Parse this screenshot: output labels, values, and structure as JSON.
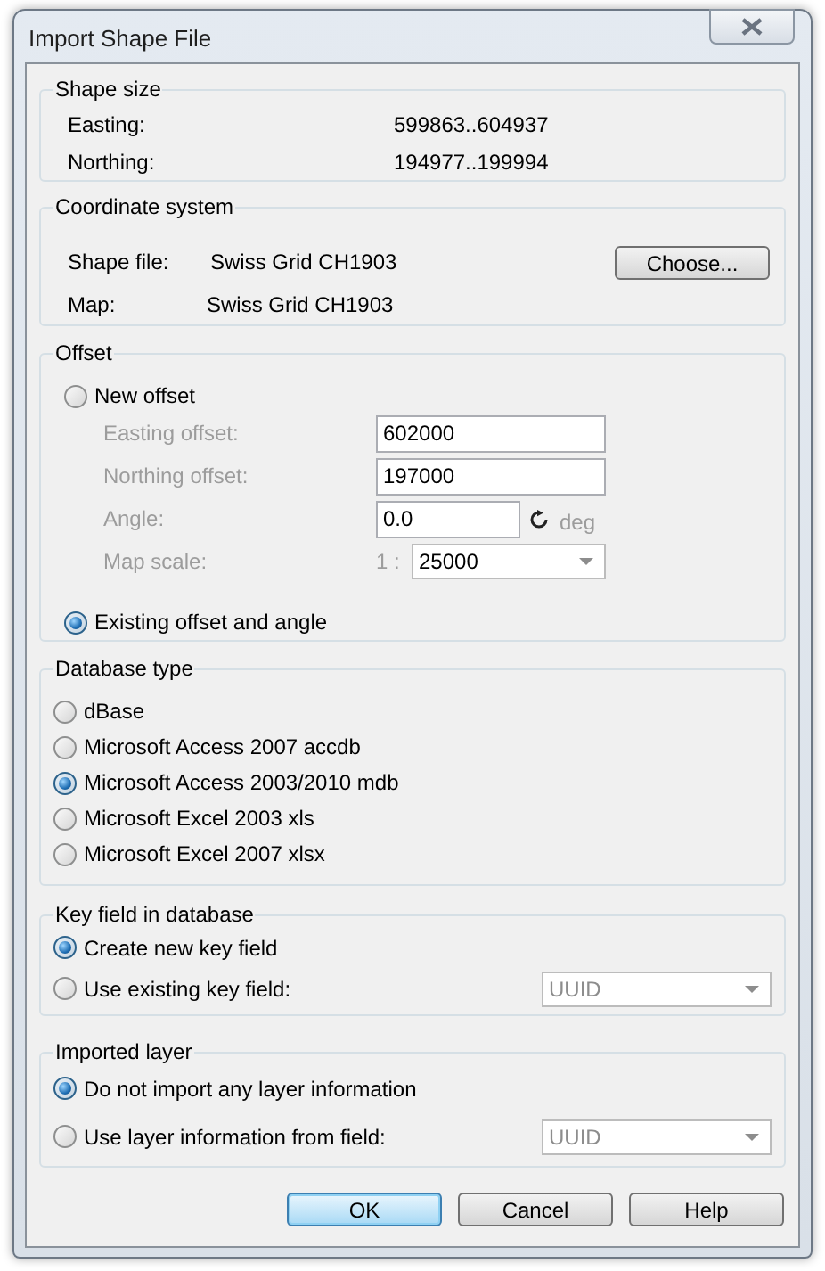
{
  "window": {
    "title": "Import Shape File"
  },
  "shape_size": {
    "title": "Shape size",
    "rows": [
      {
        "label": "Easting:",
        "value": "599863..604937"
      },
      {
        "label": "Northing:",
        "value": "194977..199994"
      }
    ]
  },
  "coordinate_system": {
    "title": "Coordinate system",
    "choose_button": "Choose...",
    "rows": [
      {
        "label": "Shape file:",
        "value": "Swiss Grid CH1903"
      },
      {
        "label": "Map:",
        "value": "Swiss Grid CH1903"
      }
    ]
  },
  "offset": {
    "title": "Offset",
    "new_offset": {
      "label": "New offset",
      "selected": false
    },
    "fields": [
      {
        "kind": "text",
        "label": "Easting offset:",
        "value": "602000",
        "disabled": true
      },
      {
        "kind": "text",
        "label": "Northing offset:",
        "value": "197000",
        "disabled": true
      },
      {
        "kind": "angle",
        "label": "Angle:",
        "value": "0.0",
        "unit": "deg",
        "disabled": true
      },
      {
        "kind": "dropdown",
        "label": "Map scale:",
        "prefix": "1 :",
        "value": "25000",
        "disabled": true
      }
    ],
    "existing_offset": {
      "label": "Existing offset and angle",
      "selected": true
    }
  },
  "database_type": {
    "title": "Database type",
    "options": [
      {
        "label": "dBase",
        "selected": false
      },
      {
        "label": "Microsoft Access 2007 accdb",
        "selected": false
      },
      {
        "label": "Microsoft Access 2003/2010 mdb",
        "selected": true
      },
      {
        "label": "Microsoft Excel 2003 xls",
        "selected": false
      },
      {
        "label": "Microsoft Excel 2007 xlsx",
        "selected": false
      }
    ]
  },
  "key_field": {
    "title": "Key field in database",
    "options": [
      {
        "label": "Create new key field",
        "selected": true
      },
      {
        "label": "Use existing key field:",
        "selected": false,
        "dropdown": {
          "value": "UUID",
          "disabled": true
        }
      }
    ]
  },
  "imported_layer": {
    "title": "Imported layer",
    "options": [
      {
        "label": "Do not import any layer information",
        "selected": true
      },
      {
        "label": "Use layer information from field:",
        "selected": false,
        "dropdown": {
          "value": "UUID",
          "disabled": true
        }
      }
    ]
  },
  "buttons": [
    {
      "label": "OK",
      "default": true
    },
    {
      "label": "Cancel",
      "default": false
    },
    {
      "label": "Help",
      "default": false
    }
  ]
}
